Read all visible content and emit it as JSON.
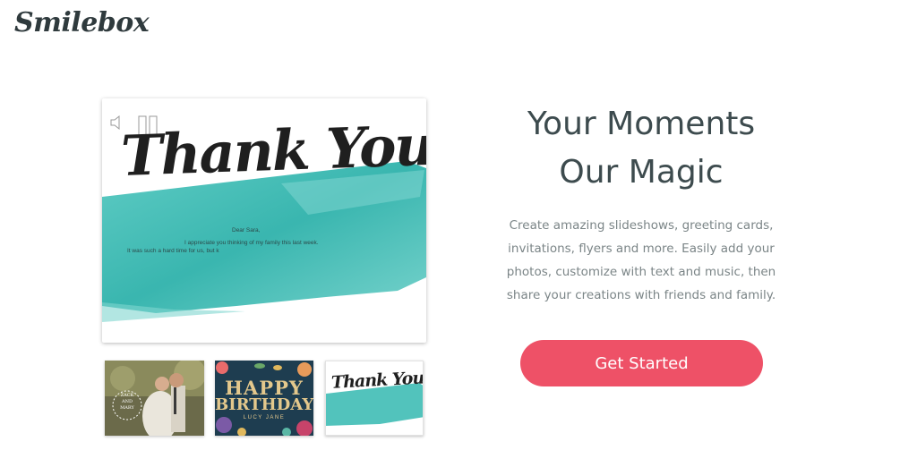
{
  "brand": {
    "logo": "Smilebox"
  },
  "preview": {
    "card_title": "Thank You!",
    "greeting": "Dear Sara,",
    "line1": "I appreciate you thinking of my family this last week.",
    "line2": "It was such a hard time for us, but k",
    "controls": {
      "sound_icon": "speaker-icon",
      "pause_icon": "pause-icon"
    },
    "accent_color": "#3fbdb5"
  },
  "thumbnails": [
    {
      "kind": "wedding",
      "names": "ZACK AND MARY"
    },
    {
      "kind": "birthday",
      "line1": "HAPPY",
      "line2": "BIRTHDAY",
      "name": "LUCY JANE"
    },
    {
      "kind": "thank-you",
      "title": "Thank You!"
    }
  ],
  "hero": {
    "title_line1": "Your Moments",
    "title_line2": "Our Magic",
    "desc_line1": "Create amazing slideshows, greeting cards,",
    "desc_line2": "invitations, flyers and more. Easily add your",
    "desc_line3": "photos, customize with text and music, then",
    "desc_line4": "share your creations with friends and family.",
    "cta_label": "Get Started",
    "cta_color": "#ee5167"
  }
}
